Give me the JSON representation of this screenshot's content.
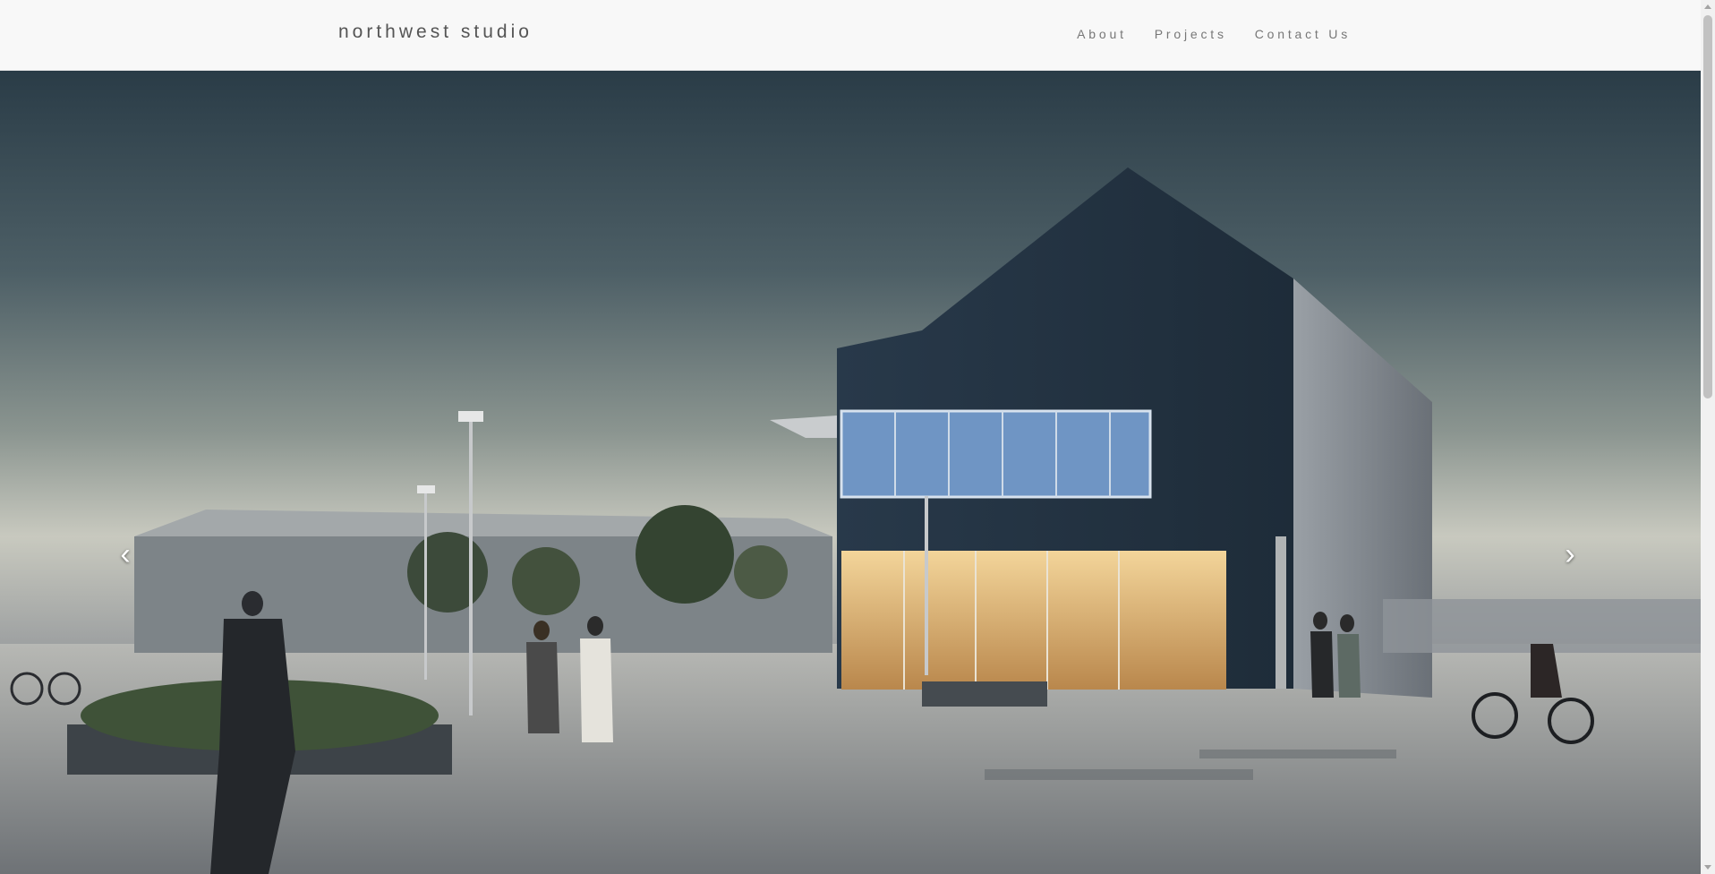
{
  "navbar": {
    "brand": "northwest studio",
    "links": [
      "About",
      "Projects",
      "Contact Us"
    ]
  },
  "carousel": {
    "prev_icon": "chevron-left-icon",
    "next_icon": "chevron-right-icon",
    "prev_glyph": "‹",
    "next_glyph": "›"
  },
  "colors": {
    "navbar_bg": "#f8f8f8",
    "brand_text": "#555555",
    "nav_link_text": "#777777"
  }
}
